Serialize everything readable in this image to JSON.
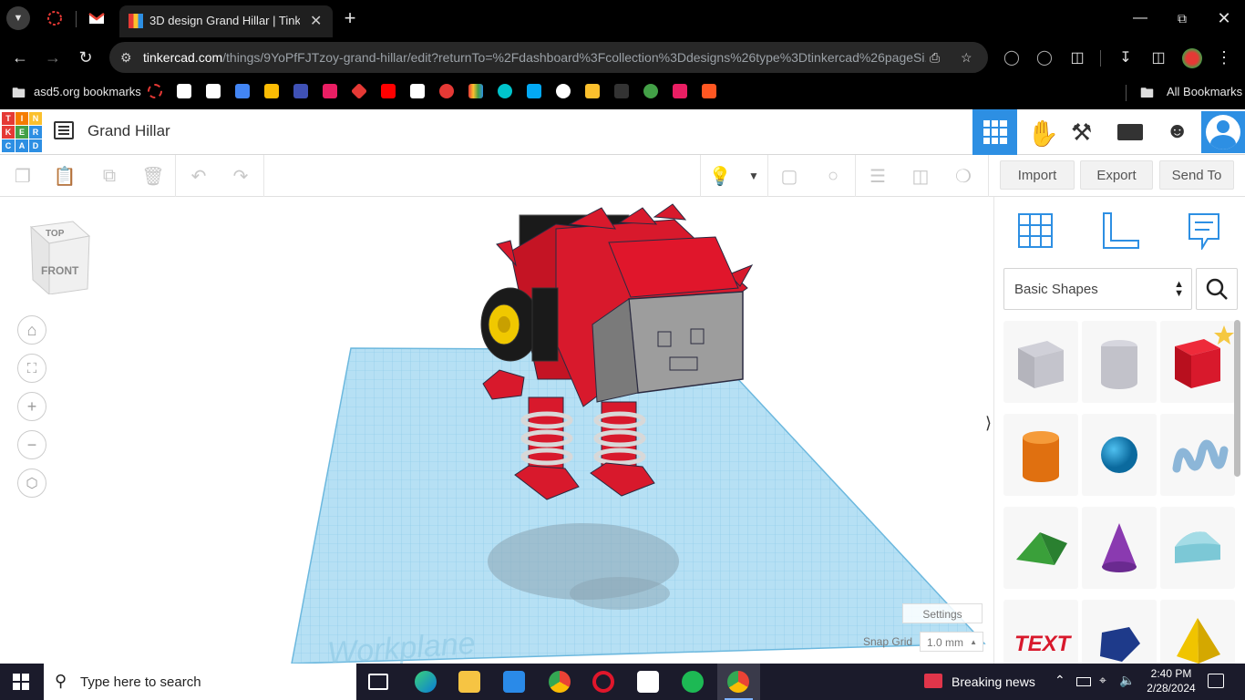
{
  "browser": {
    "tab_title": "3D design Grand Hillar | Tinkerc",
    "url_host": "tinkercad.com",
    "url_path": "/things/9YoPfFJTzoy-grand-hillar/edit?returnTo=%2Fdashboard%3Fcollection%3Ddesigns%26type%3Dtinkercad%26pageSi...",
    "bookmarks_folder": "asd5.org bookmarks",
    "all_bookmarks": "All Bookmarks"
  },
  "app": {
    "logo_letters": [
      "T",
      "I",
      "N",
      "K",
      "E",
      "R",
      "C",
      "A",
      "D"
    ],
    "design_title": "Grand Hillar"
  },
  "toolbar": {
    "import_label": "Import",
    "export_label": "Export",
    "send_to_label": "Send To"
  },
  "viewcube": {
    "top": "TOP",
    "front": "FRONT"
  },
  "workplane": {
    "watermark": "Workplane",
    "settings_label": "Settings",
    "snap_grid_label": "Snap Grid",
    "snap_grid_value": "1.0 mm"
  },
  "panel": {
    "category": "Basic Shapes",
    "shapes": [
      "box",
      "cylinder",
      "red-box",
      "orange-cylinder",
      "sphere",
      "scribble",
      "roof",
      "cone",
      "round-roof",
      "text",
      "polygon",
      "pyramid"
    ]
  },
  "taskbar": {
    "search_placeholder": "Type here to search",
    "news": "Breaking news",
    "time": "2:40 PM",
    "date": "2/28/2024"
  },
  "colors": {
    "tinkercad_blue": "#2d8fe3",
    "grid_blue": "#a8d8f0",
    "robot_red": "#e0162b"
  }
}
